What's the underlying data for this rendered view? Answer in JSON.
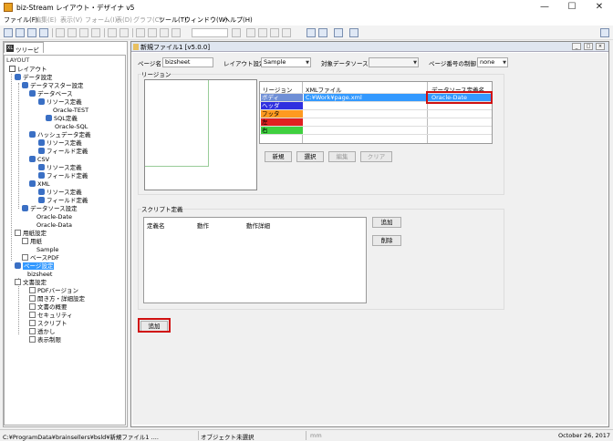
{
  "window": {
    "title": "biz-Stream レイアウト・デザイナ v5",
    "minimize": "—",
    "maximize": "☐",
    "close": "✕"
  },
  "menu": [
    {
      "label": "ファイル(F)",
      "enabled": true
    },
    {
      "label": "編集(E)",
      "enabled": false
    },
    {
      "label": "表示(V)",
      "enabled": false
    },
    {
      "label": "フォーム(I)",
      "enabled": false
    },
    {
      "label": "表(D)",
      "enabled": false
    },
    {
      "label": "グラフ(C)",
      "enabled": false
    },
    {
      "label": "ツール(T)",
      "enabled": true
    },
    {
      "label": "ウィンドウ(W)",
      "enabled": true
    },
    {
      "label": "ヘルプ(H)",
      "enabled": true
    }
  ],
  "tree": {
    "tab_label": "ツリービュー",
    "tab_icon": "XL",
    "section_label": "LAYOUT",
    "nodes": [
      {
        "label": "レイアウト"
      },
      {
        "label": "データ設定"
      },
      {
        "label": "データマスター設定"
      },
      {
        "label": "データベース"
      },
      {
        "label": "リソース定義"
      },
      {
        "label": "Oracle-TEST"
      },
      {
        "label": "SQL定義"
      },
      {
        "label": "Oracle-SQL"
      },
      {
        "label": "ハッシュデータ定義"
      },
      {
        "label": "リソース定義"
      },
      {
        "label": "フィールド定義"
      },
      {
        "label": "CSV"
      },
      {
        "label": "リソース定義"
      },
      {
        "label": "フィールド定義"
      },
      {
        "label": "XML"
      },
      {
        "label": "リソース定義"
      },
      {
        "label": "フィールド定義"
      },
      {
        "label": "データソース設定"
      },
      {
        "label": "Oracle-Date"
      },
      {
        "label": "Oracle-Data"
      },
      {
        "label": "用紙設定"
      },
      {
        "label": "用紙"
      },
      {
        "label": "Sample"
      },
      {
        "label": "ベースPDF"
      },
      {
        "label": "ページ設定"
      },
      {
        "label": "bizsheet"
      },
      {
        "label": "文書設定"
      },
      {
        "label": "PDFバージョン"
      },
      {
        "label": "開き方・詳細設定"
      },
      {
        "label": "文書の概要"
      },
      {
        "label": "セキュリティ"
      },
      {
        "label": "スクリプト"
      },
      {
        "label": "透かし"
      },
      {
        "label": "表示制限"
      }
    ]
  },
  "document": {
    "title": "新規ファイル1 [v5.0.0]",
    "page_name_label": "ページ名",
    "page_name_value": "bizsheet",
    "layout_setting_label": "レイアウト設定",
    "layout_setting_value": "Sample",
    "target_ds_label": "対象データソース",
    "target_ds_value": "",
    "page_number_label": "ページ番号の制御",
    "page_number_value": "none",
    "region_group_label": "リージョン",
    "region_table": {
      "headers": [
        "リージョン",
        "XMLファイル",
        "データソース定義名"
      ],
      "rows": [
        {
          "region": "ボディ",
          "xml": "C:¥Work¥page.xml",
          "ds": "Oracle-Date",
          "color": "#6f8fd6"
        },
        {
          "region": "ヘッダ",
          "xml": "",
          "ds": "",
          "color": "#2f2fe0"
        },
        {
          "region": "フッタ",
          "xml": "",
          "ds": "",
          "color": "#ff9a20"
        },
        {
          "region": "左",
          "xml": "",
          "ds": "",
          "color": "#e02020"
        },
        {
          "region": "右",
          "xml": "",
          "ds": "",
          "color": "#40d040"
        }
      ]
    },
    "region_buttons": [
      "新規",
      "選択",
      "編集",
      "クリア"
    ],
    "script_group_label": "スクリプト定義",
    "script_headers": [
      "定義名",
      "動作",
      "動作詳細"
    ],
    "script_add": "追加",
    "script_delete": "削除",
    "add_button": "追加"
  },
  "status": {
    "path": "C:¥ProgramData¥brainsellers¥bsld¥新規ファイル1 ....",
    "object": "オブジェクト未選択",
    "unit": "mm",
    "date": "October 26, 2017"
  }
}
